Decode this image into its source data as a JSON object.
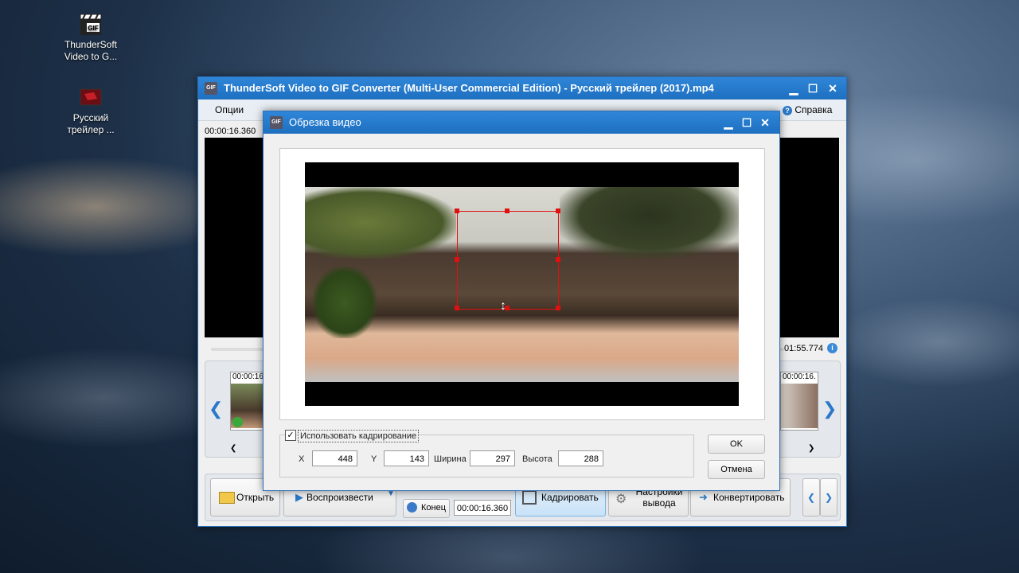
{
  "desktop": {
    "icons": [
      {
        "label": "ThunderSoft Video to G..."
      },
      {
        "label": "Русский трейлер ..."
      }
    ]
  },
  "main_window": {
    "title": "ThunderSoft Video to GIF Converter (Multi-User Commercial Edition) - Русский трейлер (2017).mp4",
    "menu_options": "Опции",
    "menu_help": "Справка",
    "time_start": "00:00:16.360",
    "time_end": "01:55.774",
    "thumb_left_time": "00:00:16",
    "thumb_right_time": "00:00:16.",
    "toolbar": {
      "open": "Открыть",
      "play": "Воспроизвести",
      "end_label": "Конец",
      "end_time": "00:00:16.360",
      "crop": "Кадрировать",
      "output_settings": "Настройки вывода",
      "convert": "Конвертировать"
    }
  },
  "crop_dialog": {
    "title": "Обрезка видео",
    "use_crop_label": "Использовать кадрирование",
    "use_crop_checked": true,
    "x_label": "X",
    "x_value": "448",
    "y_label": "Y",
    "y_value": "143",
    "width_label": "Ширина",
    "width_value": "297",
    "height_label": "Высота",
    "height_value": "288",
    "ok": "OK",
    "cancel": "Отмена"
  },
  "colors": {
    "titlebar": "#1e6fc0",
    "crop_handle": "#e01010"
  }
}
